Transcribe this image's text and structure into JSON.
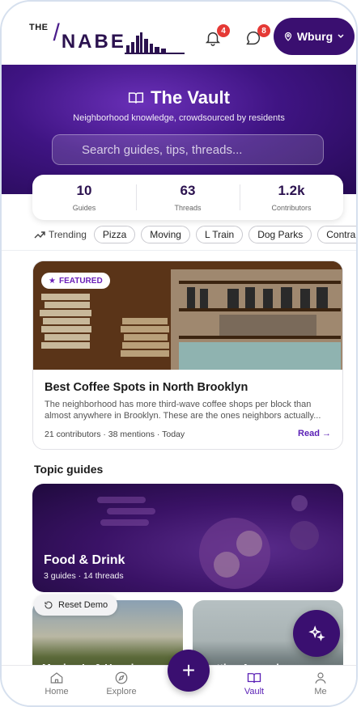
{
  "header": {
    "logo_the": "THE",
    "logo_slash": "/",
    "logo_nabe": "NABE",
    "notifications_count": "4",
    "messages_count": "8",
    "location_label": "Wburg"
  },
  "hero": {
    "title": "The Vault",
    "subtitle": "Neighborhood knowledge, crowdsourced by residents",
    "search_placeholder": "Search guides, tips, threads..."
  },
  "stats": [
    {
      "value": "10",
      "label": "Guides"
    },
    {
      "value": "63",
      "label": "Threads"
    },
    {
      "value": "1.2k",
      "label": "Contributors"
    }
  ],
  "trending": {
    "label": "Trending",
    "chips": [
      "Pizza",
      "Moving",
      "L Train",
      "Dog Parks",
      "Contra"
    ]
  },
  "featured": {
    "badge": "FEATURED",
    "title": "Best Coffee Spots in North Brooklyn",
    "description": "The neighborhood has more third-wave coffee shops per block than almost anywhere in Brooklyn. These are the ones neighbors actually...",
    "meta": "21 contributors · 38 mentions · Today",
    "read_label": "Read →"
  },
  "topics": {
    "section_title": "Topic guides",
    "items": [
      {
        "title": "Food & Drink",
        "meta": "3 guides · 14 threads"
      },
      {
        "title": "Moving In & Housing"
      },
      {
        "title": "Getting Around"
      }
    ]
  },
  "reset_label": "Reset Demo",
  "nav": {
    "items": [
      "Home",
      "Explore",
      "Vault",
      "Me"
    ],
    "plus": "+"
  },
  "colors": {
    "brand_purple": "#3a0f70",
    "accent": "#5b21b6",
    "badge_red": "#e53935"
  }
}
